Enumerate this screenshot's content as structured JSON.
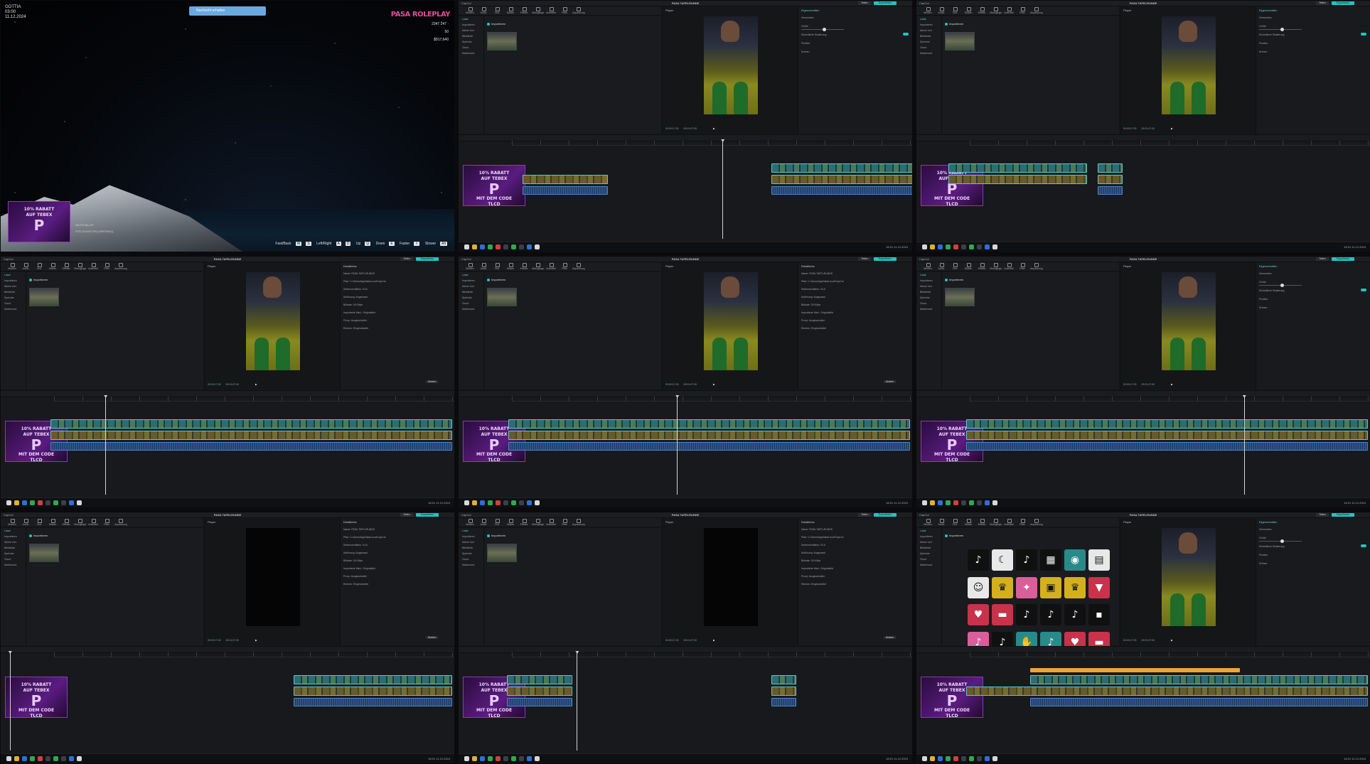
{
  "game": {
    "time": "03:00",
    "date": "11.12.2024",
    "tag": "GOTTIA",
    "notification": "Nachricht erhalten",
    "server_name": "PASA ROLEPLAY",
    "stats": [
      "2347  247  ·",
      "50",
      "$917,640"
    ],
    "players": [
      "NICHTSALOS",
      "STR SCHATTEN (VERTRAG)"
    ],
    "controls": {
      "fast_back": "Fast/Back",
      "fast_back_keys": [
        "W",
        "S"
      ],
      "left_right": "Left/Right",
      "left_right_keys": [
        "A",
        "D"
      ],
      "up": "Up",
      "up_key": "Q",
      "down": "Down",
      "down_key": "E",
      "faster": "Faster",
      "faster_key": "⇧",
      "slower": "Slower",
      "slower_key": "Alt"
    }
  },
  "promo": {
    "line1": "10% RABATT",
    "line2": "AUF TEBEX",
    "letter": "P",
    "line3": "MIT DEM CODE",
    "line4": "TLCD"
  },
  "editor": {
    "brand": "CapCut",
    "project_name": "PASA TAFELRUNDE",
    "export_label": "Exportieren",
    "share_label": "Teilen",
    "toolbar": [
      "Medien",
      "Audio",
      "Text",
      "Sticker",
      "Effekte",
      "Übergänge",
      "Untertitel",
      "Filter",
      "Anpassung"
    ],
    "sidebar": [
      "Lokal",
      "Importieren",
      "Meine Vorl.",
      "Bibliothek",
      "Speicher",
      "Cloud",
      "Markenvorl."
    ],
    "import_label": "Importieren",
    "player_label": "Player",
    "properties_header": "Eigenschaften",
    "properties_rows": [
      "Verwenden",
      "Größe",
      "Einheitliche Skalierung",
      "Position",
      "Drehen"
    ],
    "details_header": "Detailinfos",
    "details_rows": [
      "Name: PASA TAFELRUNDE",
      "Pfad: C:/Users/AppData/Local/CapCut",
      "Seitenverhältnis: 9:16",
      "Auflösung: Angepasst",
      "Bildrate: 30.00fps",
      "Importierte Med.: Originalbild",
      "Proxy: Ausgeschaltet",
      "Ebenen: Eingeschaltet"
    ],
    "details_button": "Ändern",
    "clip_label": "PASA-IMG0001.mp4  00:00:00",
    "timecode": "00:00:17:03",
    "duration": "00:01:07:00",
    "stickers": [
      "♪",
      "☾",
      "♪",
      "▦",
      "◉",
      "▤",
      "☺",
      "♛",
      "✦",
      "▣",
      "♛",
      "▼",
      "♥",
      "▬",
      "♪",
      "♪",
      "♪",
      "▪",
      "♪",
      "♪",
      "✋",
      "♪",
      "♥",
      "▬"
    ]
  },
  "taskbar": {
    "clock": "18:01  11.12.2024"
  }
}
